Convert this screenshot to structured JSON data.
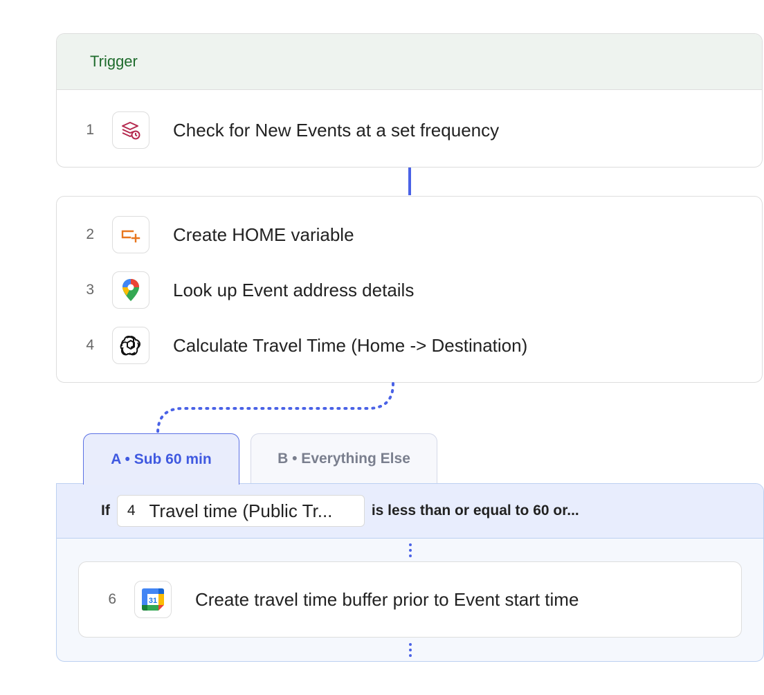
{
  "trigger": {
    "header": "Trigger",
    "step": {
      "number": "1",
      "label": "Check for New Events at a set frequency",
      "icon": "schedule-stack-icon"
    }
  },
  "actions": [
    {
      "number": "2",
      "label": "Create HOME variable",
      "icon": "variable-add-icon"
    },
    {
      "number": "3",
      "label": "Look up Event address details",
      "icon": "google-maps-pin-icon"
    },
    {
      "number": "4",
      "label": "Calculate Travel Time (Home -> Destination)",
      "icon": "openai-icon"
    }
  ],
  "paths": {
    "tabs": [
      {
        "label": "A • Sub 60 min",
        "active": true
      },
      {
        "label": "B • Everything Else",
        "active": false
      }
    ],
    "condition": {
      "if_label": "If",
      "field_step": "4",
      "field_label": "Travel time (Public Tr...",
      "rest": "is less than or equal to 60 or..."
    },
    "inner_step": {
      "number": "6",
      "label": "Create travel time buffer prior to Event start time",
      "icon": "google-calendar-icon"
    }
  },
  "colors": {
    "accent": "#4a62e6",
    "trigger_green": "#1e6b2c"
  }
}
